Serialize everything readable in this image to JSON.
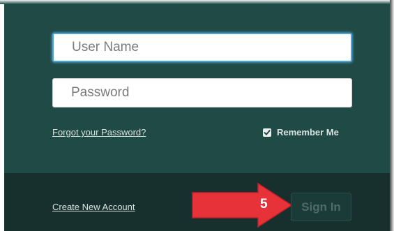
{
  "login": {
    "username_placeholder": "User Name",
    "password_placeholder": "Password",
    "forgot_password": "Forgot your Password?",
    "remember_me": "Remember Me",
    "remember_me_checked": true,
    "create_account": "Create New Account",
    "sign_in": "Sign In"
  },
  "annotation": {
    "step_number": "5",
    "arrow_color": "#e8323a"
  },
  "colors": {
    "panel": "#1f4a46",
    "footer": "#17302e",
    "focus_border": "#4da3d8"
  }
}
